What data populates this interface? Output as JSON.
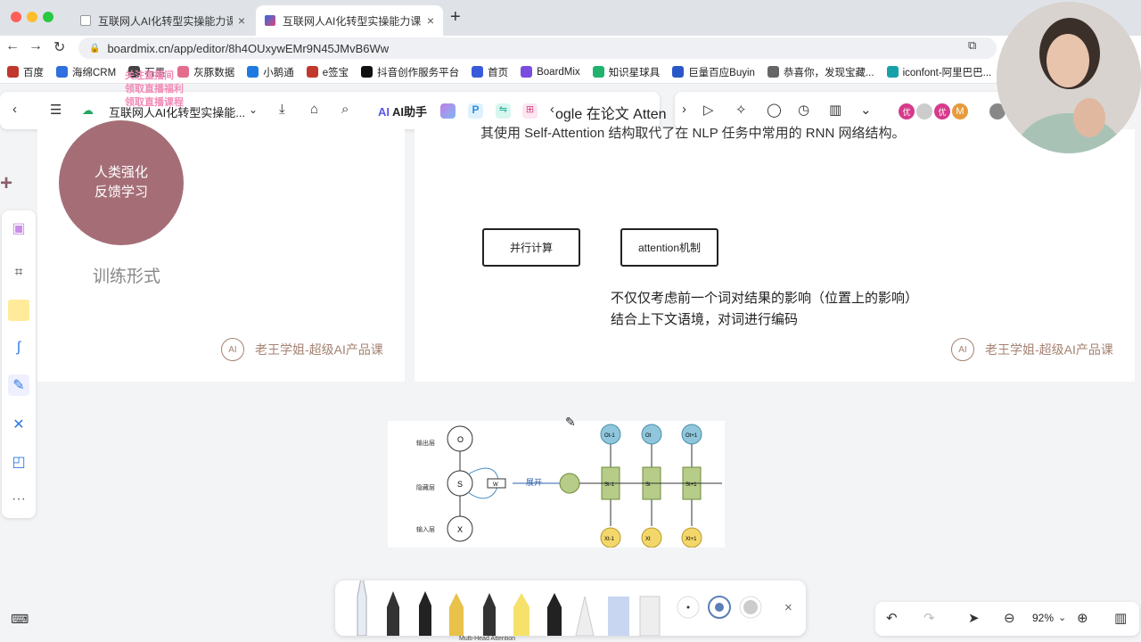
{
  "browser": {
    "tabs": [
      {
        "label": "互联网人AI化转型实操能力课-大",
        "active": false
      },
      {
        "label": "互联网人AI化转型实操能力课 - b",
        "active": true
      }
    ],
    "new_tab": "+",
    "url": "boardmix.cn/app/editor/8h4OUxywEMr9N45JMvB6Ww"
  },
  "bookmarks": [
    {
      "label": "百度",
      "color": "#c0392b"
    },
    {
      "label": "海绵CRM",
      "color": "#2f6fde"
    },
    {
      "label": "石墨",
      "color": "#444444"
    },
    {
      "label": "灰豚数据",
      "color": "#e46d8e"
    },
    {
      "label": "小鹅通",
      "color": "#1f7ae0"
    },
    {
      "label": "e签宝",
      "color": "#c0392b"
    },
    {
      "label": "抖音创作服务平台",
      "color": "#111111"
    },
    {
      "label": "首页",
      "color": "#3a5bd9"
    },
    {
      "label": "BoardMix",
      "color": "#7a4ce0"
    },
    {
      "label": "知识星球具",
      "color": "#21b26f"
    },
    {
      "label": "巨量百应Buyin",
      "color": "#2a57c7"
    },
    {
      "label": "恭喜你，发现宝藏...",
      "color": "#666666"
    },
    {
      "label": "iconfont-阿里巴巴...",
      "color": "#17a0a8"
    }
  ],
  "toolbar": {
    "doc_title": "互联网人AI化转型实操能...",
    "ai_label": "AI助手",
    "ai_logo": "AI",
    "google_text": "ogle 在论文 Atten"
  },
  "overlay_pink_text": [
    "关注直播间",
    "领取直播福利",
    "领取直播课程"
  ],
  "left_frame": {
    "circle_line1": "人类强化",
    "circle_line2": "反馈学习",
    "caption": "训练形式",
    "watermark": "老王学姐-超级AI产品课"
  },
  "right_frame": {
    "top_text": "其使用 Self-Attention 结构取代了在 NLP 任务中常用的 RNN 网络结构。",
    "box1": "并行计算",
    "box2": "attention机制",
    "note_line1": "不仅仅考虑前一个词对结果的影响（位置上的影响）",
    "note_line2": "结合上下文语境，对词进行编码",
    "watermark": "老王学姐-超级AI产品课"
  },
  "rnn_diagram": {
    "row_labels": [
      "输出层",
      "隐藏层",
      "输入层"
    ],
    "node_o": "O",
    "node_s": "S",
    "node_x": "X",
    "w_label": "W",
    "v_label": "V",
    "u_label": "U",
    "unfold_label": "展开",
    "s_nodes": [
      "St-1",
      "St",
      "St+1"
    ],
    "o_nodes": [
      "Ot-1",
      "Ot",
      "Ot+1"
    ],
    "x_nodes": [
      "Xt-1",
      "Xt",
      "Xt+1"
    ],
    "caption_below": "Multi-Head Attention"
  },
  "zoom": {
    "level": "92%"
  },
  "colors": {
    "accent": "#5a55e8",
    "circle": "#a56e77",
    "watermark": "#a58272"
  }
}
